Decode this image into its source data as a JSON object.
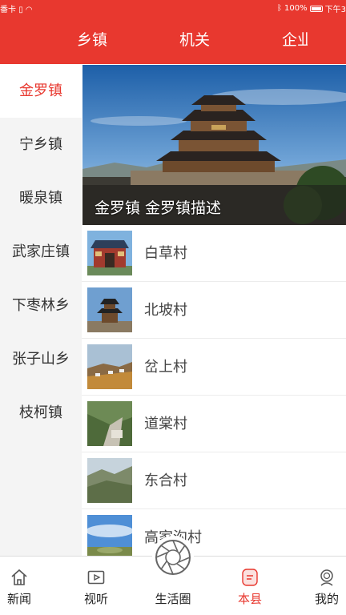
{
  "status_bar": {
    "carrier": "番卡",
    "battery": "100%",
    "time": "下午3"
  },
  "top_tabs": [
    "乡镇",
    "机关",
    "企业"
  ],
  "sidebar": {
    "items": [
      {
        "label": "金罗镇",
        "active": true
      },
      {
        "label": "宁乡镇",
        "active": false
      },
      {
        "label": "暖泉镇",
        "active": false
      },
      {
        "label": "武家庄镇",
        "active": false
      },
      {
        "label": "下枣林乡",
        "active": false
      },
      {
        "label": "张子山乡",
        "active": false
      },
      {
        "label": "枝柯镇",
        "active": false
      }
    ]
  },
  "banner": {
    "caption": "金罗镇 金罗镇描述",
    "image": "ancient-tower-photo"
  },
  "villages": [
    {
      "name": "白草村",
      "thumb": "temple-gate-photo"
    },
    {
      "name": "北坡村",
      "thumb": "tower-photo"
    },
    {
      "name": "岔上村",
      "thumb": "hillside-village-photo"
    },
    {
      "name": "道棠村",
      "thumb": "cliff-road-photo"
    },
    {
      "name": "东合村",
      "thumb": "mountain-valley-photo"
    },
    {
      "name": "高家沟村",
      "thumb": "sky-field-photo"
    }
  ],
  "bottom_nav": [
    {
      "label": "新闻",
      "icon": "home-icon",
      "active": false
    },
    {
      "label": "视听",
      "icon": "video-icon",
      "active": false
    },
    {
      "label": "生活圈",
      "icon": "camera-shutter-icon",
      "active": false
    },
    {
      "label": "本县",
      "icon": "county-icon",
      "active": true
    },
    {
      "label": "我的",
      "icon": "profile-icon",
      "active": false
    }
  ],
  "colors": {
    "accent": "#e8382f",
    "sidebar_bg": "#f4f4f4"
  }
}
